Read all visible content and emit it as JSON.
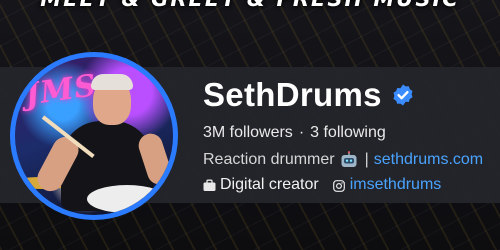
{
  "banner": {
    "text": "MEET & GREET & FRESH MUSIC"
  },
  "profile": {
    "name": "SethDrums",
    "verified_icon": "verified-badge-icon",
    "followers": "3M followers",
    "separator": "·",
    "following": "3 following",
    "bio_text": "Reaction drummer",
    "bio_icon": "robot-emoji-icon",
    "bio_separator": "|",
    "website": "sethdrums.com",
    "category_icon": "briefcase-icon",
    "category": "Digital creator",
    "instagram_icon": "instagram-icon",
    "instagram": "imsethdrums"
  },
  "avatar": {
    "neon_sign": "JMS"
  },
  "colors": {
    "accent": "#4aa3ff",
    "ring": "#2a7bff",
    "card": "#23252b",
    "banner_mark": "#f2c21b"
  }
}
